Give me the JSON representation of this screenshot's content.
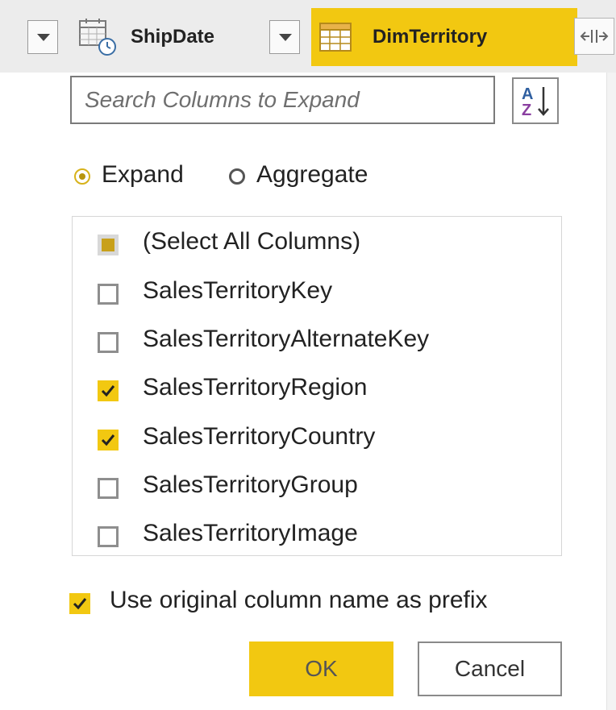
{
  "header": {
    "columns": [
      {
        "label": "ShipDate",
        "icon": "calendar-clock-icon"
      },
      {
        "label": "DimTerritory",
        "icon": "table-icon",
        "active": true
      }
    ],
    "expand_icon": "expand-column-icon"
  },
  "search": {
    "placeholder": "Search Columns to Expand",
    "value": ""
  },
  "sort": {
    "icon": "sort-az-icon",
    "label": "AZ"
  },
  "mode": {
    "options": [
      {
        "label": "Expand",
        "selected": true
      },
      {
        "label": "Aggregate",
        "selected": false
      }
    ]
  },
  "columns_list": {
    "items": [
      {
        "label": "(Select All Columns)",
        "state": "partial"
      },
      {
        "label": "SalesTerritoryKey",
        "state": "unchecked"
      },
      {
        "label": "SalesTerritoryAlternateKey",
        "state": "unchecked"
      },
      {
        "label": "SalesTerritoryRegion",
        "state": "checked"
      },
      {
        "label": "SalesTerritoryCountry",
        "state": "checked"
      },
      {
        "label": "SalesTerritoryGroup",
        "state": "unchecked"
      },
      {
        "label": "SalesTerritoryImage",
        "state": "unchecked"
      }
    ]
  },
  "prefix": {
    "label": "Use original column name as prefix",
    "checked": true
  },
  "buttons": {
    "ok": "OK",
    "cancel": "Cancel"
  },
  "colors": {
    "accent": "#f2c811",
    "partial": "#c8a01a",
    "border": "#8e8e8e"
  }
}
